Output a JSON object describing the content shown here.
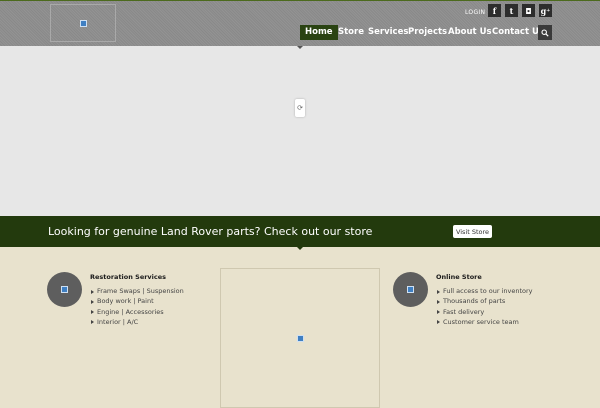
{
  "header": {
    "login_label": "LOGIN",
    "social": [
      {
        "icon": "facebook-icon",
        "glyph": "f"
      },
      {
        "icon": "twitter-icon",
        "glyph": "t"
      },
      {
        "icon": "instagram-icon",
        "glyph": "◘"
      },
      {
        "icon": "google-plus-icon",
        "glyph": "g⁺"
      }
    ],
    "nav": [
      "Home",
      "Store",
      "Services",
      "Projects",
      "About Us",
      "Contact Us"
    ],
    "active_nav": "Home"
  },
  "banner": {
    "text": "Looking for genuine Land Rover parts? Check out our store",
    "button_label": "Visit Store"
  },
  "blocks": {
    "left": {
      "title": "Restoration Services",
      "items": [
        "Frame Swaps | Suspension",
        "Body work | Paint",
        "Engine | Accessories",
        "Interior | A/C"
      ]
    },
    "right": {
      "title": "Online Store",
      "items": [
        "Full access to our inventory",
        "Thousands of parts",
        "Fast delivery",
        "Customer service team"
      ]
    }
  },
  "colors": {
    "header_bg": "#8d8d8d",
    "nav_active": "#2a4312",
    "banner_bg": "#233a0d",
    "content_bg": "#e8e2cd",
    "slider_bg": "#e7e7e7"
  }
}
